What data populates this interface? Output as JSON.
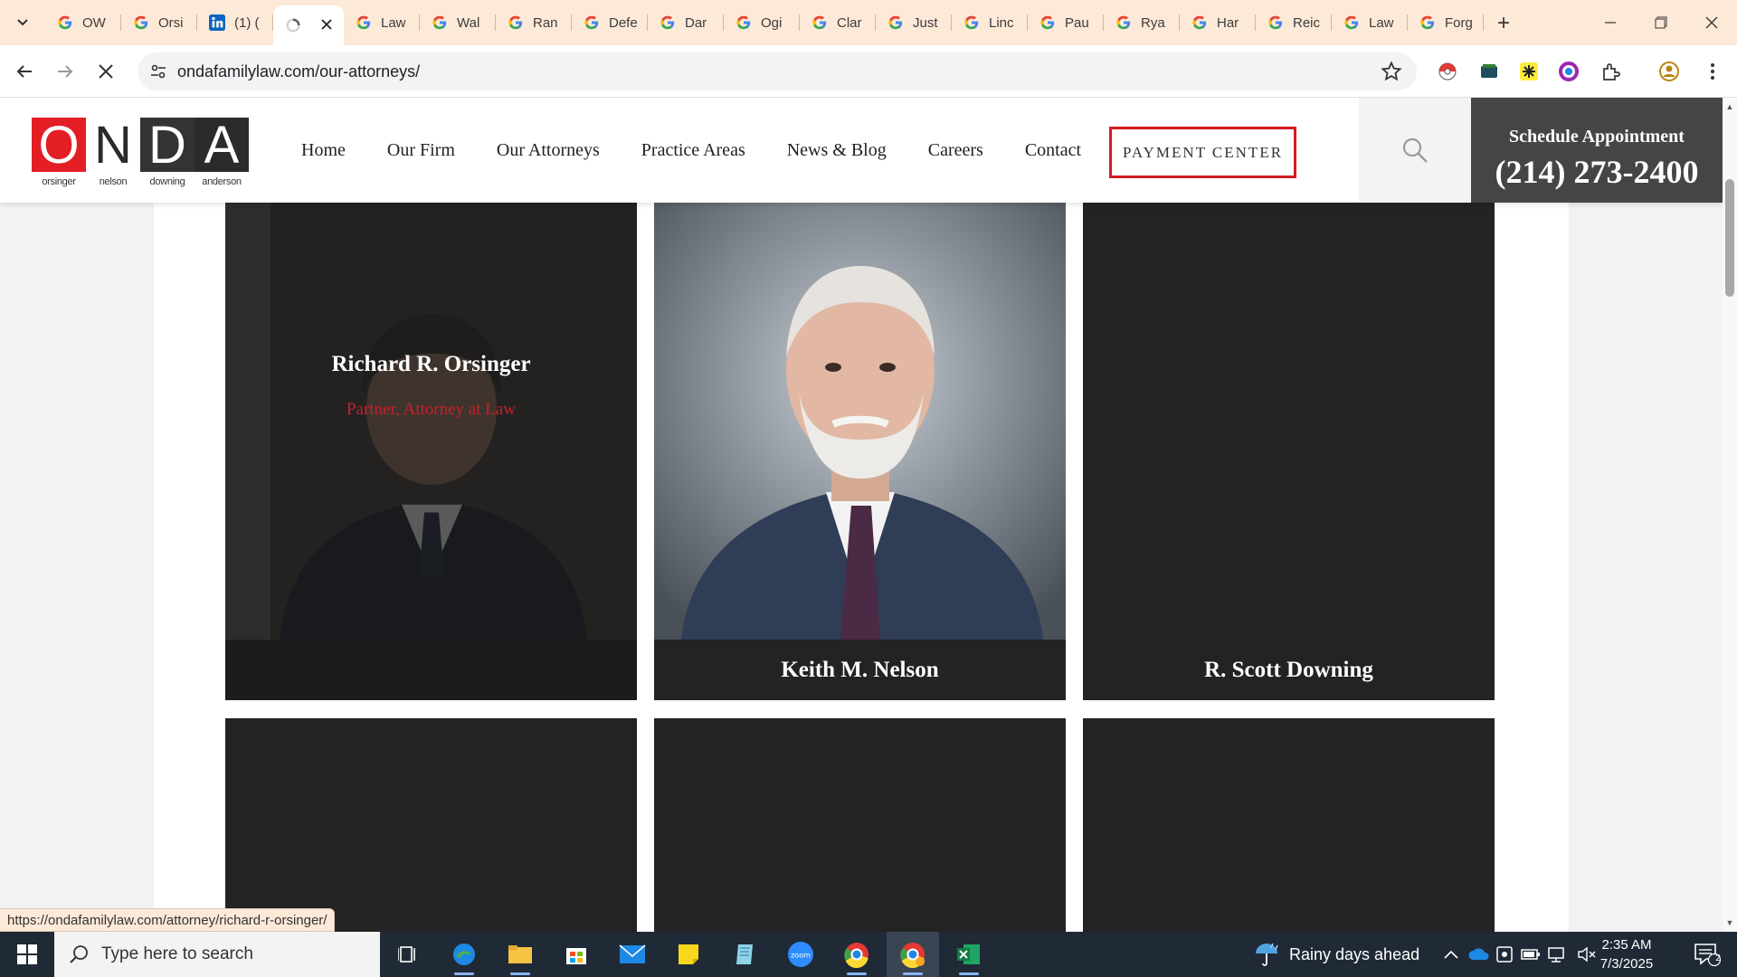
{
  "browser": {
    "tabs": [
      {
        "label": "OW",
        "icon": "google-g-icon"
      },
      {
        "label": "Orsi",
        "icon": "google-g-icon"
      },
      {
        "label": "(1) (",
        "icon": "linkedin-icon"
      },
      {
        "label": "",
        "icon": "loading-icon",
        "active": true
      },
      {
        "label": "Law",
        "icon": "google-g-icon"
      },
      {
        "label": "Wal",
        "icon": "google-g-icon"
      },
      {
        "label": "Ran",
        "icon": "google-g-icon"
      },
      {
        "label": "Defe",
        "icon": "google-g-icon"
      },
      {
        "label": "Dar",
        "icon": "google-g-icon"
      },
      {
        "label": "Ogi",
        "icon": "google-g-icon"
      },
      {
        "label": "Clar",
        "icon": "google-g-icon"
      },
      {
        "label": "Just",
        "icon": "google-g-icon"
      },
      {
        "label": "Linc",
        "icon": "google-g-icon"
      },
      {
        "label": "Pau",
        "icon": "google-g-icon"
      },
      {
        "label": "Rya",
        "icon": "google-g-icon"
      },
      {
        "label": "Har",
        "icon": "google-g-icon"
      },
      {
        "label": "Reic",
        "icon": "google-g-icon"
      },
      {
        "label": "Law",
        "icon": "google-g-icon"
      },
      {
        "label": "Forg",
        "icon": "google-g-icon"
      }
    ],
    "new_tab_label": "+",
    "url": "ondafamilylaw.com/our-attorneys/",
    "status_url": "https://ondafamilylaw.com/attorney/richard-r-orsinger/"
  },
  "site": {
    "logo": {
      "letters": [
        "O",
        "N",
        "D",
        "A"
      ],
      "names": [
        "orsinger",
        "nelson",
        "downing",
        "anderson"
      ]
    },
    "nav": [
      "Home",
      "Our Firm",
      "Our Attorneys",
      "Practice Areas",
      "News & Blog",
      "Careers",
      "Contact"
    ],
    "payment_button": "PAYMENT CENTER",
    "schedule_label": "Schedule Appointment",
    "phone": "(214) 273-2400",
    "attorneys": [
      {
        "name": "Richard R. Orsinger",
        "role": "Partner, Attorney at Law"
      },
      {
        "name": "Keith M. Nelson"
      },
      {
        "name": "R. Scott Downing"
      }
    ]
  },
  "taskbar": {
    "search_placeholder": "Type here to search",
    "weather": "Rainy days ahead",
    "time": "2:35 AM",
    "date": "7/3/2025",
    "notification_count": "2"
  },
  "colors": {
    "brand_red": "#e31e24",
    "tabstrip": "#fde9d8",
    "card_dark": "#232323"
  }
}
